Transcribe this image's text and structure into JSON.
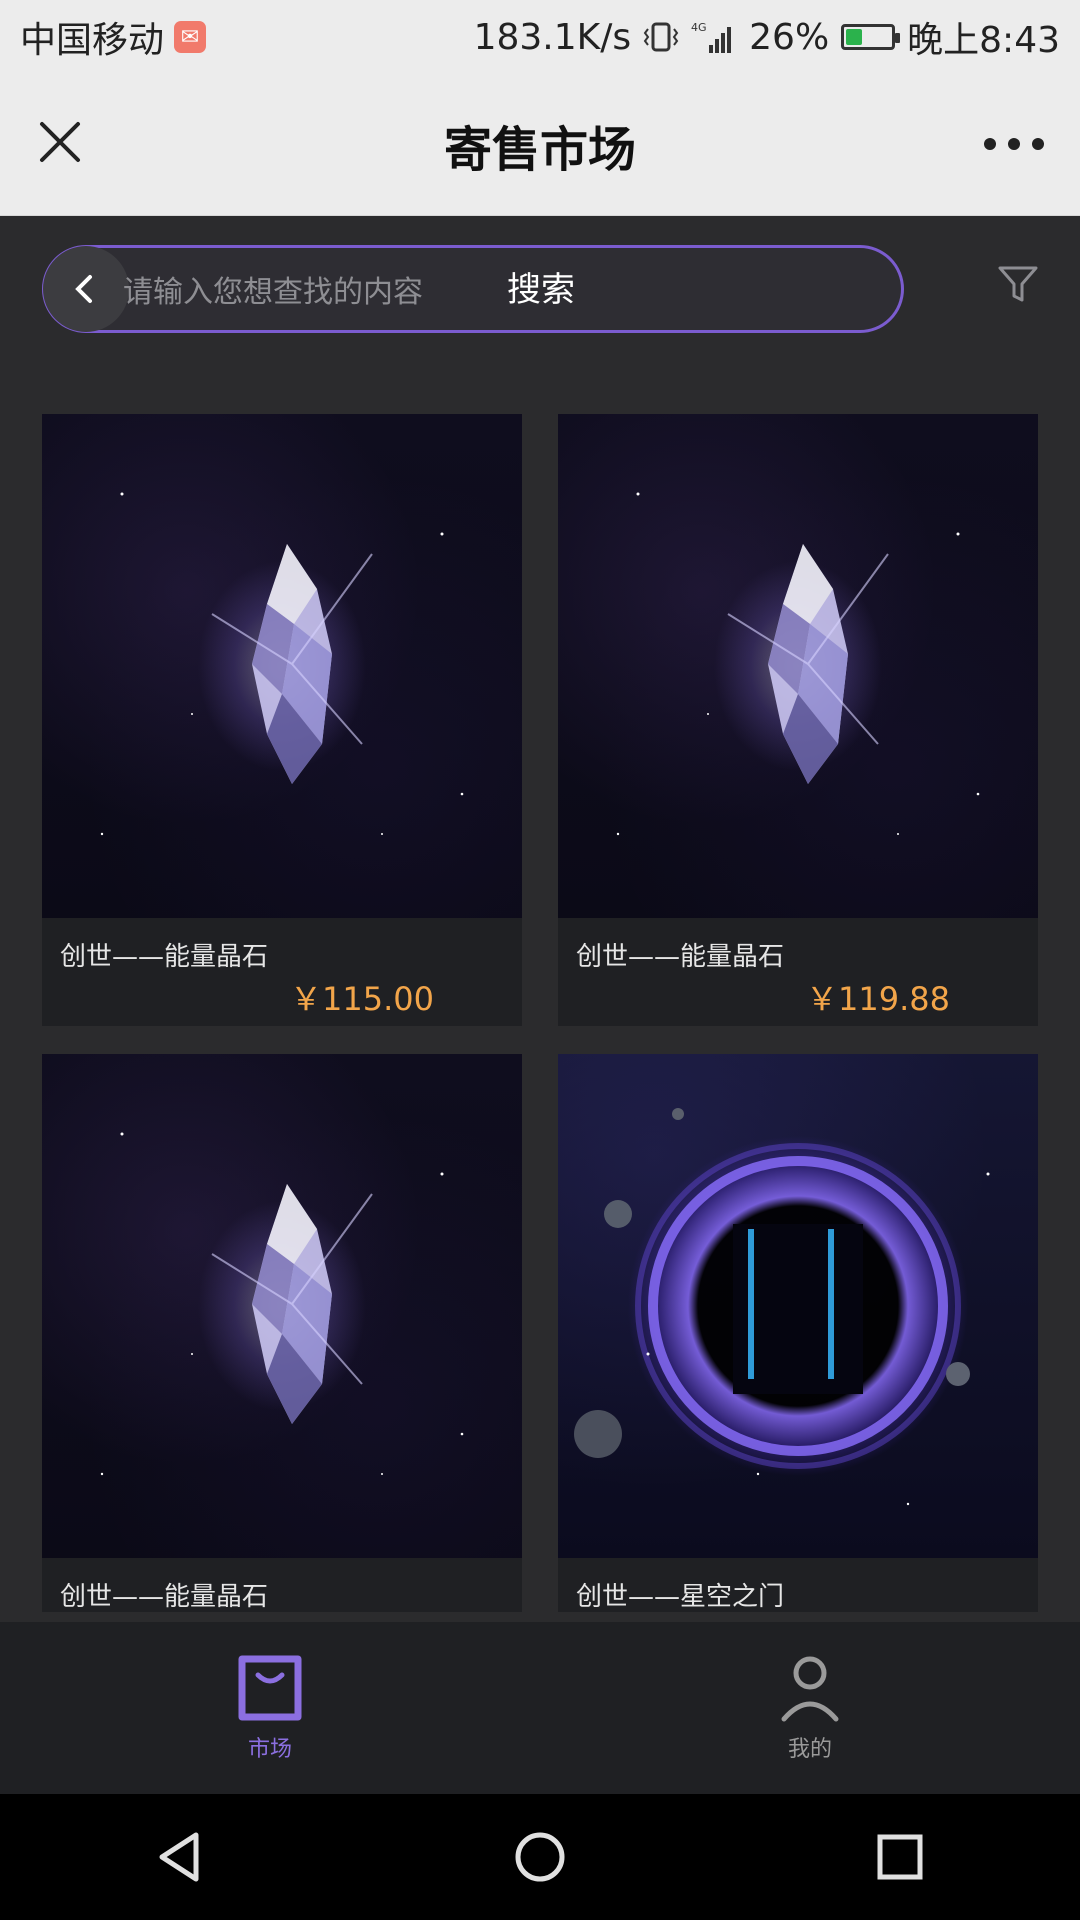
{
  "status": {
    "carrier": "中国移动",
    "speed": "183.1K/s",
    "network": "4G",
    "battery": "26%",
    "time": "晚上8:43"
  },
  "header": {
    "title": "寄售市场"
  },
  "search": {
    "placeholder": "请输入您想查找的内容",
    "button_label": "搜索"
  },
  "products": [
    {
      "name": "创世——能量晶石",
      "price": "￥115.00",
      "image": "crystal"
    },
    {
      "name": "创世——能量晶石",
      "price": "￥119.88",
      "image": "crystal"
    },
    {
      "name": "创世——能量晶石",
      "price": "",
      "image": "crystal"
    },
    {
      "name": "创世——星空之门",
      "price": "",
      "image": "portal"
    }
  ],
  "bottom_nav": {
    "market": "市场",
    "mine": "我的",
    "active_color": "#8b6fe0",
    "inactive_color": "#9a9a9a"
  },
  "colors": {
    "accent": "#7b5ccf",
    "price": "#f2a54a"
  }
}
